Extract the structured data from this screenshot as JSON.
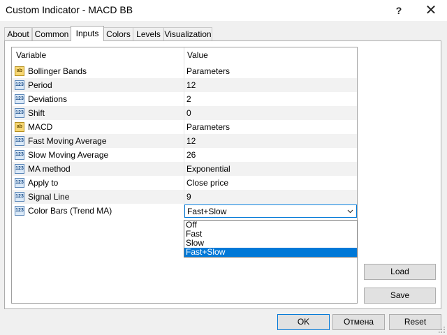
{
  "window": {
    "title": "Custom Indicator - MACD BB",
    "help_glyph": "?",
    "close_glyph": "✕"
  },
  "tabs": [
    {
      "label": "About"
    },
    {
      "label": "Common"
    },
    {
      "label": "Inputs",
      "active": true
    },
    {
      "label": "Colors"
    },
    {
      "label": "Levels"
    },
    {
      "label": "Visualization"
    }
  ],
  "grid": {
    "headers": {
      "variable": "Variable",
      "value": "Value"
    },
    "rows": [
      {
        "icon": "ab",
        "name": "Bollinger Bands",
        "value": "Parameters"
      },
      {
        "icon": "123",
        "name": "Period",
        "value": "12"
      },
      {
        "icon": "123",
        "name": "Deviations",
        "value": "2"
      },
      {
        "icon": "123",
        "name": "Shift",
        "value": "0"
      },
      {
        "icon": "ab",
        "name": "MACD",
        "value": "Parameters"
      },
      {
        "icon": "123",
        "name": "Fast Moving Average",
        "value": "12"
      },
      {
        "icon": "123",
        "name": "Slow Moving Average",
        "value": "26"
      },
      {
        "icon": "123",
        "name": "MA method",
        "value": "Exponential"
      },
      {
        "icon": "123",
        "name": "Apply to",
        "value": "Close price"
      },
      {
        "icon": "123",
        "name": "Signal Line",
        "value": "9"
      },
      {
        "icon": "123",
        "name": "Color Bars (Trend MA)",
        "value": "Fast+Slow",
        "editing": true
      }
    ]
  },
  "dropdown": {
    "options": [
      "Off",
      "Fast",
      "Slow",
      "Fast+Slow"
    ],
    "selected": "Fast+Slow"
  },
  "side_buttons": {
    "load": "Load",
    "save": "Save"
  },
  "bottom_buttons": {
    "ok": "OK",
    "cancel": "Отмена",
    "reset": "Reset"
  },
  "colors": {
    "accent": "#0078d7",
    "icon_ab": "#f7d774",
    "icon_num": "#dbe9f7"
  }
}
